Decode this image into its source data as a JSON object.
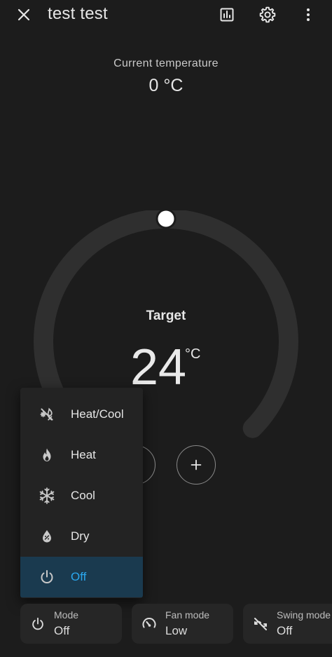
{
  "header": {
    "title": "test test",
    "icons": [
      "close-icon",
      "history-icon",
      "gear-icon",
      "more-vertical-icon"
    ]
  },
  "current": {
    "label": "Current temperature",
    "value": "0 °C"
  },
  "target": {
    "label": "Target",
    "value": "24",
    "unit": "°C",
    "setpoint_fraction": 0.5
  },
  "controls": {
    "minus_icon": "minus-icon",
    "plus_icon": "plus-icon"
  },
  "mode_menu": {
    "items": [
      {
        "label": "Heat/Cool",
        "icon": "heat-cool-icon",
        "selected": false
      },
      {
        "label": "Heat",
        "icon": "flame-icon",
        "selected": false
      },
      {
        "label": "Cool",
        "icon": "snowflake-icon",
        "selected": false
      },
      {
        "label": "Dry",
        "icon": "water-drop-icon",
        "selected": false
      },
      {
        "label": "Off",
        "icon": "power-icon",
        "selected": true
      }
    ]
  },
  "features": [
    {
      "name": "Mode",
      "value": "Off",
      "icon": "power-icon"
    },
    {
      "name": "Fan mode",
      "value": "Low",
      "icon": "fan-speed-icon"
    },
    {
      "name": "Swing mode",
      "value": "Off",
      "icon": "swing-off-icon"
    }
  ],
  "colors": {
    "background": "#1c1c1c",
    "accent": "#2aa7ef",
    "selected_bg": "#1a3a4f",
    "track": "#2f2f2f"
  }
}
